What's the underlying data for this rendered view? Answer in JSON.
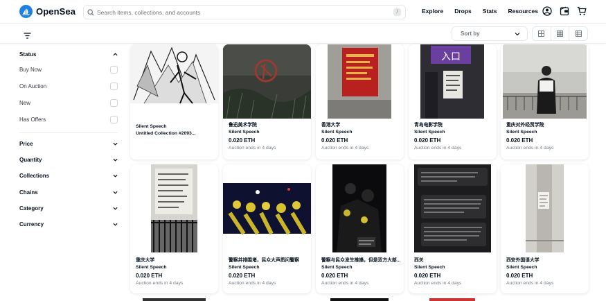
{
  "header": {
    "brand": "OpenSea",
    "search_placeholder": "Search items, collections, and accounts",
    "search_shortcut": "/",
    "nav": [
      "Explore",
      "Drops",
      "Stats",
      "Resources"
    ],
    "icons": [
      "profile-icon",
      "wallet-icon",
      "cart-icon"
    ]
  },
  "toolbar": {
    "sort_label": "Sort by",
    "view_modes": [
      "large-grid-icon",
      "small-grid-icon",
      "list-icon"
    ]
  },
  "sidebar": {
    "status_label": "Status",
    "status_options": [
      "Buy Now",
      "On Auction",
      "New",
      "Has Offers"
    ],
    "sections": [
      "Price",
      "Quantity",
      "Collections",
      "Chains",
      "Category",
      "Currency"
    ]
  },
  "cards": [
    {
      "title": "Silent Speech",
      "collection": "Untitled Collection #2093...",
      "price": "",
      "auction": ""
    },
    {
      "title": "鲁迅美术学院",
      "collection": "Silent Speech",
      "price": "0.020 ETH",
      "auction": "Auction ends in 4 days"
    },
    {
      "title": "香港大学",
      "collection": "Silent Speech",
      "price": "0.020 ETH",
      "auction": "Auction ends in 4 days"
    },
    {
      "title": "青岛电影学院",
      "collection": "Silent Speech",
      "price": "0.020 ETH",
      "auction": "Auction ends in 4 days"
    },
    {
      "title": "重庆对外经贸学院",
      "collection": "Silent Speech",
      "price": "0.020 ETH",
      "auction": "Auction ends in 4 days"
    },
    {
      "title": "重庆大学",
      "collection": "Silent Speech",
      "price": "0.020 ETH",
      "auction": "Auction ends in 4 days"
    },
    {
      "title": "警察并排围堵，民众大声质问警察",
      "collection": "Silent Speech",
      "price": "0.020 ETH",
      "auction": "Auction ends in 4 days"
    },
    {
      "title": "警察与民众发生推搡，但是双方大部...",
      "collection": "Silent Speech",
      "price": "0.020 ETH",
      "auction": "Auction ends in 4 days"
    },
    {
      "title": "西关",
      "collection": "Silent Speech",
      "price": "0.020 ETH",
      "auction": "Auction ends in 4 days"
    },
    {
      "title": "西安外国语大学",
      "collection": "Silent Speech",
      "price": "0.020 ETH",
      "auction": "Auction ends in 4 days"
    }
  ],
  "image_texts": {
    "sign_entrance": "入口"
  },
  "colors": {
    "brand_blue": "#2081e2",
    "text_primary": "#04111d",
    "text_secondary": "#707a83",
    "border": "#e5e8eb"
  }
}
